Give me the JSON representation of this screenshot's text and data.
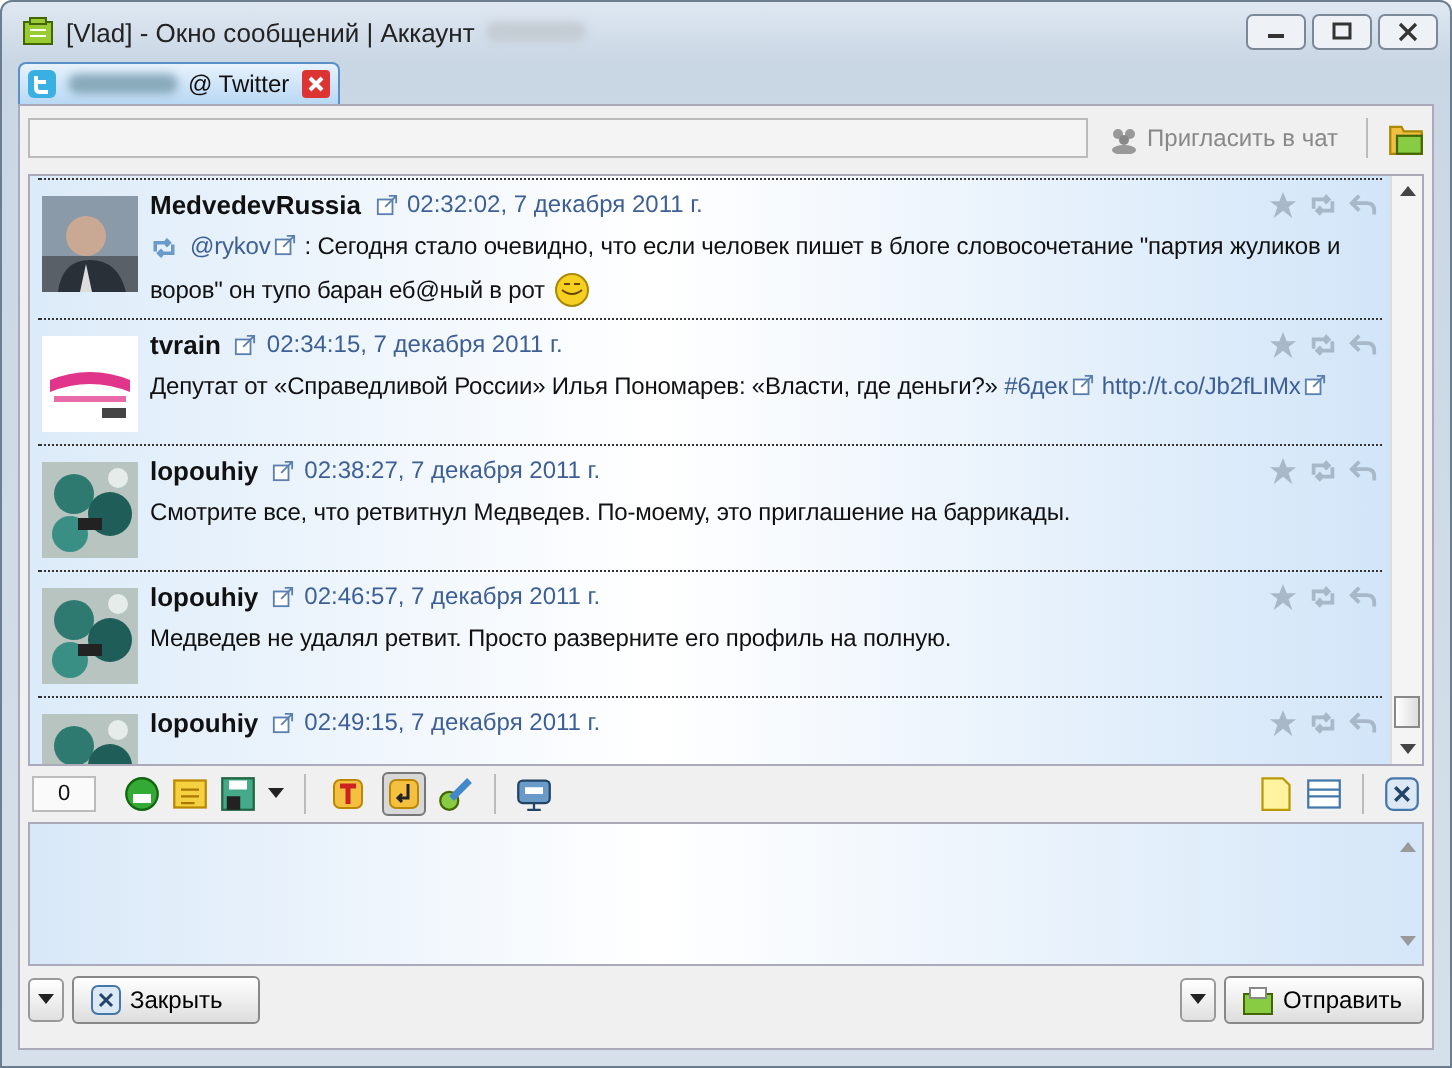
{
  "window": {
    "title": "[Vlad] - Окно сообщений | Аккаунт"
  },
  "tabs": [
    {
      "label": "@ Twitter",
      "selected": true
    }
  ],
  "toolbar": {
    "invite_button": "Пригласить в чат"
  },
  "messages": [
    {
      "author": "MedvedevRussia",
      "time": "02:32:02, 7 декабря 2011 г.",
      "retweet": true,
      "emoticon": true,
      "parts": [
        {
          "kind": "link",
          "text": "@rykov"
        },
        {
          "kind": "plain",
          "text": ": Сегодня стало очевидно, что если человек пишет в блоге словосочетание \"партия жуликов и воров\" он тупо баран еб@ный в рот"
        }
      ]
    },
    {
      "author": "tvrain",
      "time": "02:34:15, 7 декабря 2011 г.",
      "retweet": false,
      "emoticon": false,
      "parts": [
        {
          "kind": "plain",
          "text": "Депутат от «Справедливой России» Илья Пономарев: «Власти, где деньги?» "
        },
        {
          "kind": "link",
          "text": "#6дек"
        },
        {
          "kind": "link",
          "text": "http://t.co/Jb2fLIMx"
        }
      ]
    },
    {
      "author": "lopouhiy",
      "time": "02:38:27, 7 декабря 2011 г.",
      "retweet": false,
      "emoticon": false,
      "parts": [
        {
          "kind": "plain",
          "text": "Смотрите все, что ретвитнул Медведев. По-моему, это приглашение на баррикады."
        }
      ]
    },
    {
      "author": "lopouhiy",
      "time": "02:46:57, 7 декабря 2011 г.",
      "retweet": false,
      "emoticon": false,
      "parts": [
        {
          "kind": "plain",
          "text": "Медведев не удалял ретвит. Просто разверните его профиль на полную."
        }
      ]
    },
    {
      "author": "lopouhiy",
      "time": "02:49:15, 7 декабря 2011 г."
    }
  ],
  "compose": {
    "counter": "0",
    "bold_pressed": false,
    "format_pressed": true
  },
  "buttons": {
    "close": "Закрыть",
    "send": "Отправить"
  }
}
